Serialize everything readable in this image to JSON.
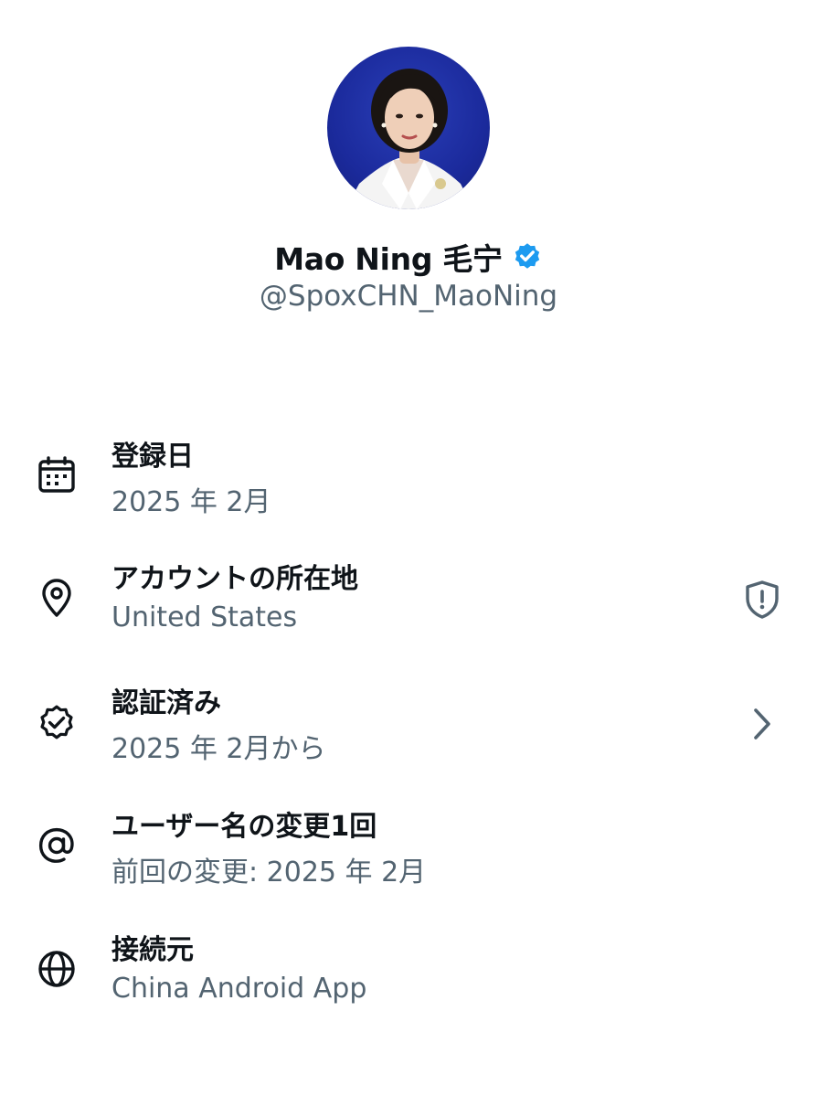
{
  "profile": {
    "display_name": "Mao Ning 毛宁",
    "handle": "@SpoxCHN_MaoNing",
    "verified": true,
    "badge_color": "#1d9bf0"
  },
  "info": [
    {
      "icon": "calendar-icon",
      "title": "登録日",
      "subtitle": "2025 年 2月"
    },
    {
      "icon": "location-pin-icon",
      "title": "アカウントの所在地",
      "subtitle": "United States",
      "right_icon": "shield-alert-icon"
    },
    {
      "icon": "verified-check-icon",
      "title": "認証済み",
      "subtitle": "2025 年 2月から",
      "right_icon": "chevron-right-icon"
    },
    {
      "icon": "at-sign-icon",
      "title": "ユーザー名の変更1回",
      "subtitle": "前回の変更: 2025 年 2月"
    },
    {
      "icon": "globe-icon",
      "title": "接続元",
      "subtitle": "China Android App"
    }
  ],
  "colors": {
    "text_primary": "#0f1419",
    "text_secondary": "#536471",
    "avatar_background": "#1b2a9c"
  }
}
